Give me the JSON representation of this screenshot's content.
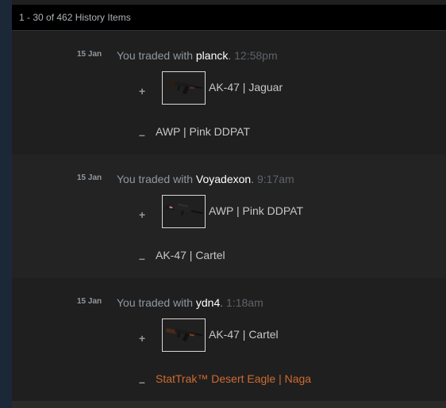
{
  "header": {
    "count_label": "1 - 30 of 462 History Items"
  },
  "trades": [
    {
      "date": "15 Jan",
      "prefix": "You traded with",
      "partner": "planck",
      "time": "12:58pm",
      "gained_symbol": "+",
      "gained_item": {
        "name": "AK-47 | Jaguar",
        "icon": "ak47-rifle-icon",
        "name_color": "#c6c7c8"
      },
      "lost_symbol": "–",
      "lost_item": {
        "name": "AWP | Pink DDPAT",
        "name_color": "#c6c7c8"
      }
    },
    {
      "date": "15 Jan",
      "prefix": "You traded with",
      "partner": "Voyadexon",
      "time": "9:17am",
      "gained_symbol": "+",
      "gained_item": {
        "name": "AWP | Pink DDPAT",
        "icon": "awp-sniper-icon",
        "name_color": "#c6c7c8"
      },
      "lost_symbol": "–",
      "lost_item": {
        "name": "AK-47 | Cartel",
        "name_color": "#c6c7c8"
      }
    },
    {
      "date": "15 Jan",
      "prefix": "You traded with",
      "partner": "ydn4",
      "time": "1:18am",
      "gained_symbol": "+",
      "gained_item": {
        "name": "AK-47 | Cartel",
        "icon": "ak47-rifle-icon",
        "name_color": "#c6c7c8"
      },
      "lost_symbol": "–",
      "lost_item": {
        "name": "StatTrak™ Desert Eagle | Naga",
        "name_color": "#cf6a32"
      }
    }
  ],
  "colors": {
    "page_bg": "#1b2838",
    "panel_bg": "#1f1f1f",
    "partner": "#ffffff",
    "muted": "#8f98a0",
    "stattrak": "#cf6a32"
  }
}
